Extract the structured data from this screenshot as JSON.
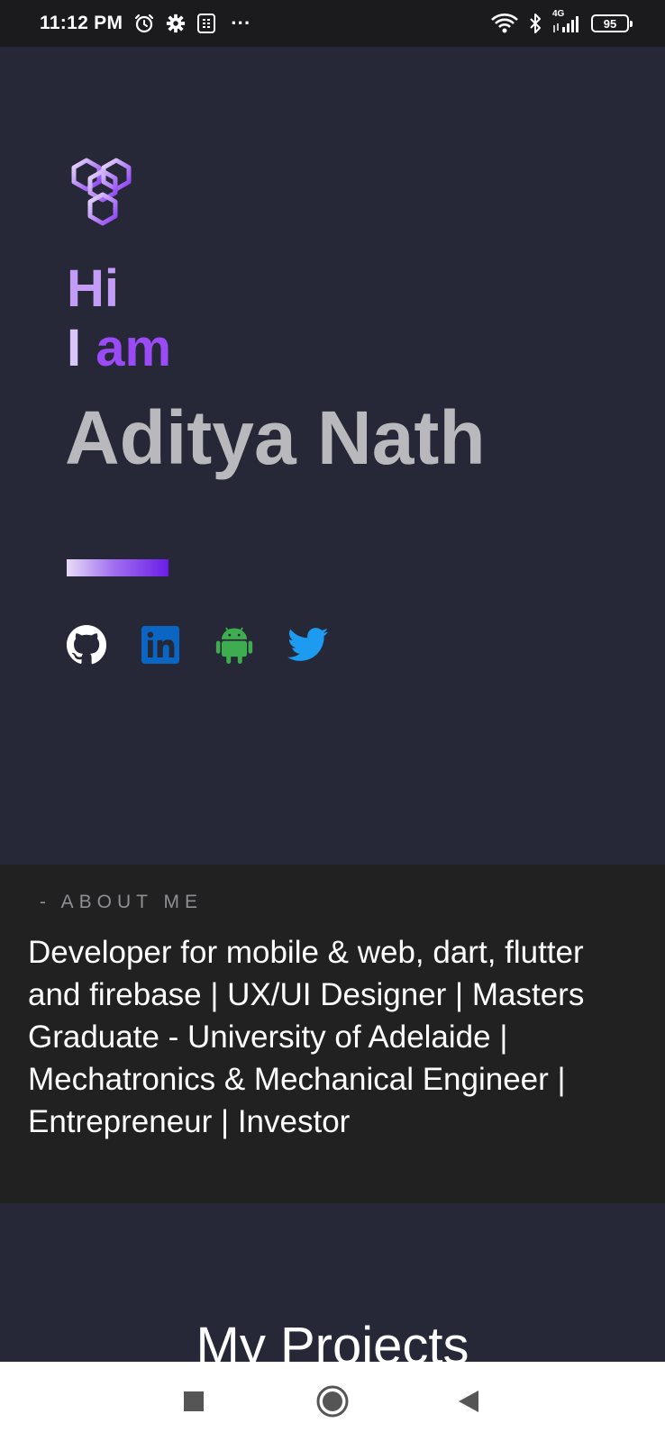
{
  "status_bar": {
    "time": "11:12 PM",
    "more": "···",
    "network": "4G",
    "battery": "95",
    "icons": [
      "alarm-icon",
      "settings-icon",
      "sim-icon",
      "wifi-icon",
      "bluetooth-icon",
      "signal-icon",
      "battery-icon"
    ]
  },
  "hero": {
    "logo_icon": "hexagon-cluster-logo",
    "greeting_hi": "Hi",
    "greeting_i": "I",
    "greeting_am": "am",
    "name": "Aditya Nath",
    "social_links": [
      {
        "icon": "github-icon",
        "color": "#ffffff"
      },
      {
        "icon": "linkedin-icon",
        "color": "#0a66c2"
      },
      {
        "icon": "android-icon",
        "color": "#3dad4f"
      },
      {
        "icon": "twitter-icon",
        "color": "#1d9bf0"
      }
    ]
  },
  "about": {
    "label": "- ABOUT ME",
    "text": "Developer for mobile & web, dart, flutter and firebase | UX/UI Designer | Masters Graduate - University of Adelaide | Mechatronics & Mechanical Engineer | Entrepreneur | Investor"
  },
  "projects": {
    "title": "My Projects"
  },
  "nav_bar": {
    "buttons": [
      "recents-button",
      "home-button",
      "back-button"
    ]
  },
  "colors": {
    "background": "#262837",
    "about_background": "#212122",
    "accent_purple": "#9b4bf5",
    "name_gray": "#b9b9bd"
  }
}
